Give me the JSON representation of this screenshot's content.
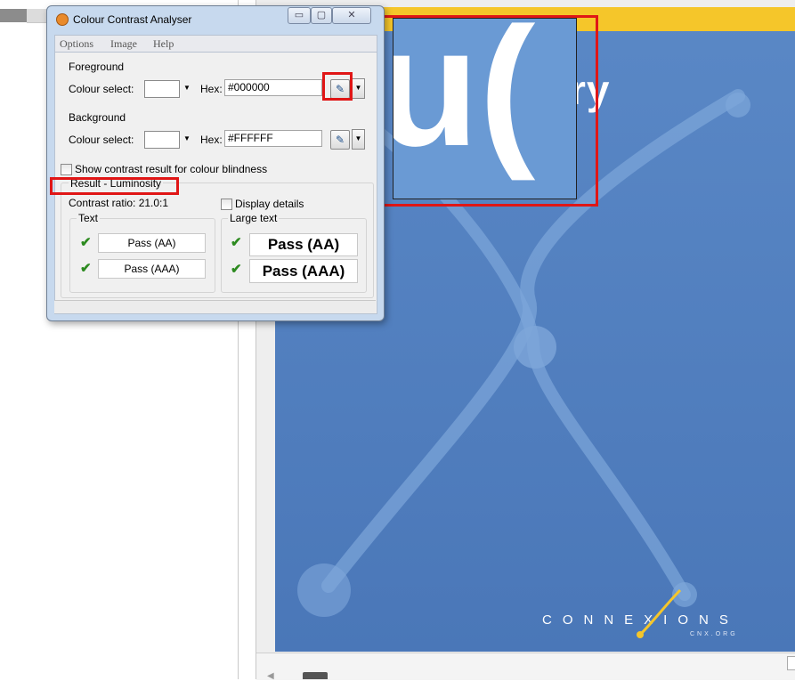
{
  "dialog": {
    "title": "Colour Contrast Analyser",
    "window_buttons": {
      "minimize": "▭",
      "maximize": "▢",
      "close": "✕"
    },
    "menu": [
      "Options",
      "Image",
      "Help"
    ],
    "foreground": {
      "section_label": "Foreground",
      "colour_select_label": "Colour select:",
      "hex_label": "Hex:",
      "hex_value": "#000000"
    },
    "background": {
      "section_label": "Background",
      "colour_select_label": "Colour select:",
      "hex_label": "Hex:",
      "hex_value": "#FFFFFF"
    },
    "colour_blindness_option": "Show contrast result for colour blindness",
    "result": {
      "label": "Result - Luminosity",
      "contrast_ratio": "Contrast ratio: 21.0:1",
      "display_details": "Display details",
      "text_group": "Text",
      "large_text_group": "Large text",
      "text_aa": "Pass (AA)",
      "text_aaa": "Pass (AAA)",
      "large_aa": "Pass (AA)",
      "large_aaa": "Pass (AAA)"
    }
  },
  "document": {
    "cover_title_fragment": "ry",
    "logo_text": "CONNEXIONS",
    "logo_sub": "CNX.ORG",
    "magnified_text": "u("
  },
  "colors": {
    "highlight": "#e01616",
    "cover_blue": "#4f7fbe",
    "cover_bar": "#f5c62a",
    "pass_check": "#2c8a1f"
  },
  "icons": {
    "app": "palette-icon",
    "picker": "eyedropper-icon",
    "pass": "checkmark-icon"
  }
}
